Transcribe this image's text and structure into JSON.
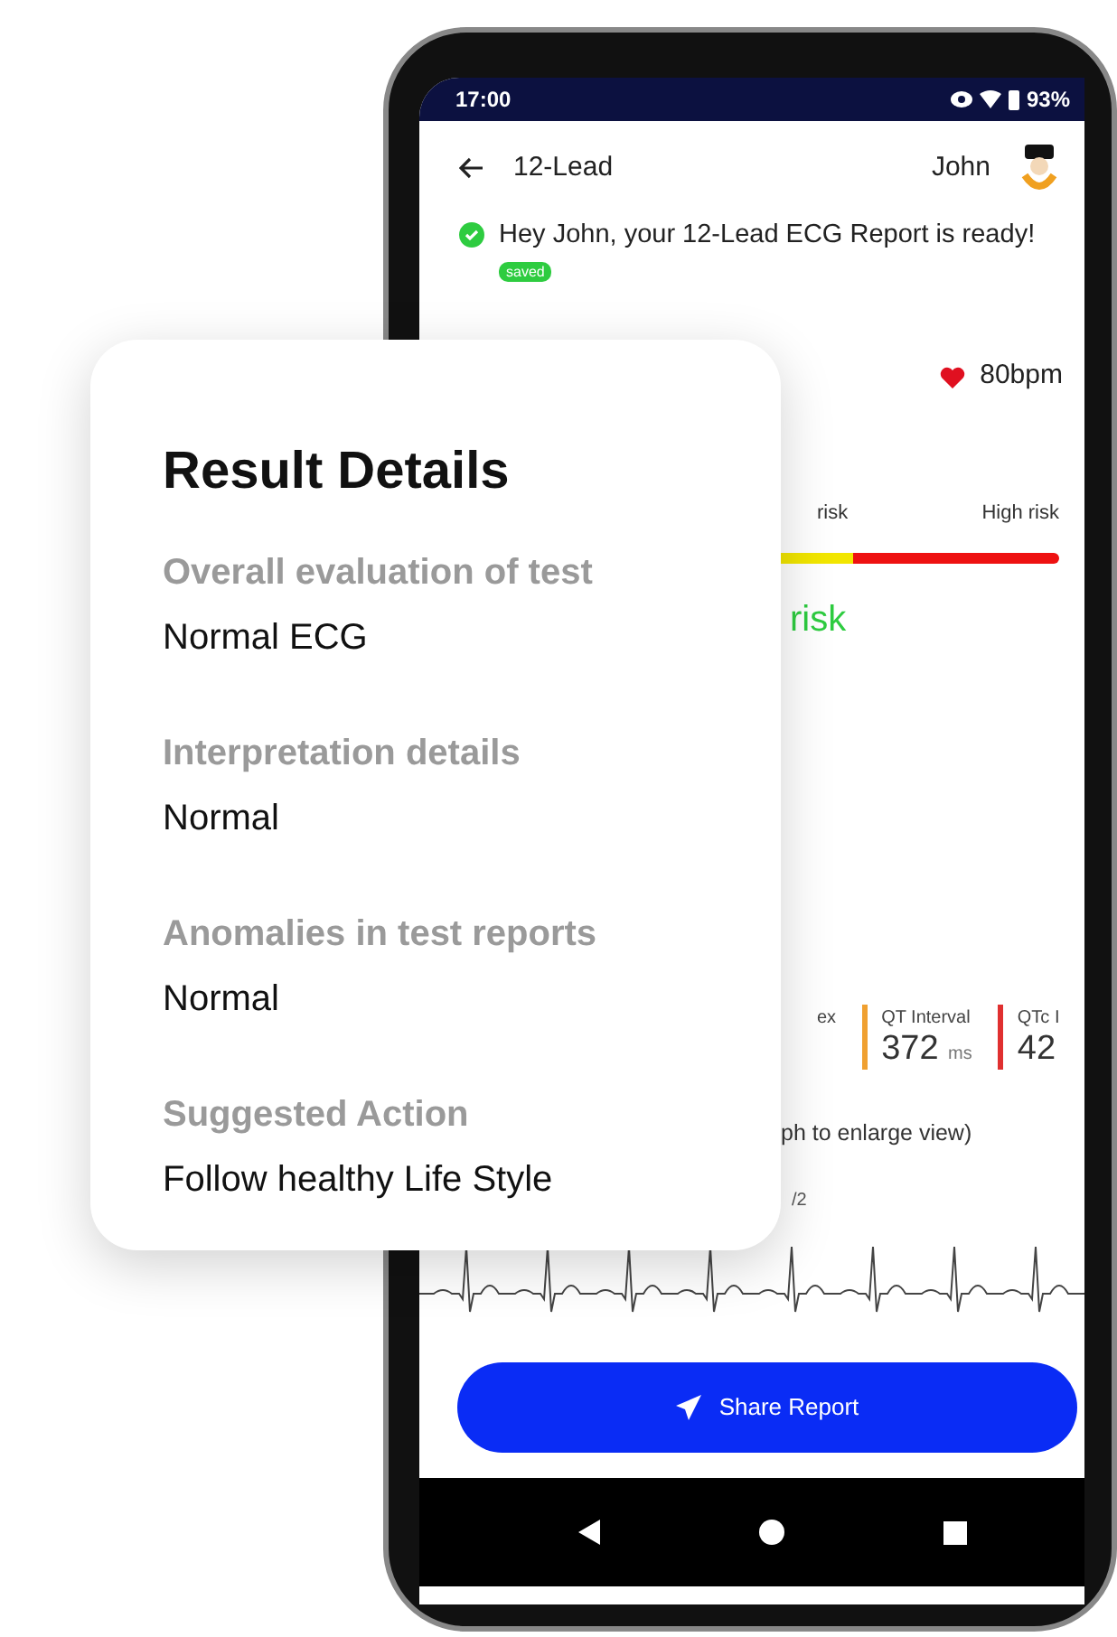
{
  "status_bar": {
    "time": "17:00",
    "battery": "93%"
  },
  "header": {
    "title": "12-Lead",
    "user": "John"
  },
  "notice": {
    "text": "Hey John, your 12-Lead ECG Report is ready!",
    "badge": "saved"
  },
  "heart_rate": "80bpm",
  "risk": {
    "labels": [
      "risk",
      "High risk"
    ],
    "segments": [
      {
        "color": "#f2e600"
      },
      {
        "color": "#ee1111"
      }
    ],
    "result": "risk"
  },
  "metrics": [
    {
      "label": "ex"
    },
    {
      "label": "QT Interval",
      "value": "372",
      "unit": "ms",
      "color": "#f0a030"
    },
    {
      "label": "QTc I",
      "value": "42",
      "color": "#e03030"
    }
  ],
  "hint": "ph to enlarge view)",
  "page": "/2",
  "share_button": "Share Report",
  "result_details": {
    "title": "Result Details",
    "fields": [
      {
        "label": "Overall evaluation of test",
        "value": "Normal ECG"
      },
      {
        "label": "Interpretation details",
        "value": "Normal"
      },
      {
        "label": "Anomalies in test reports",
        "value": "Normal"
      },
      {
        "label": "Suggested Action",
        "value": "Follow healthy Life Style"
      }
    ]
  }
}
